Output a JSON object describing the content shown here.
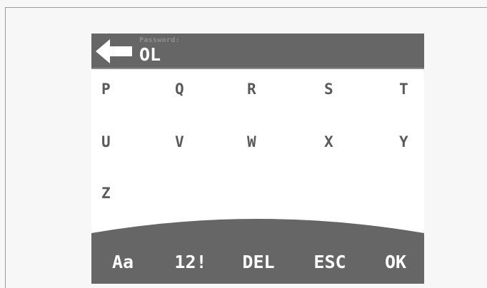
{
  "password": {
    "label": "Password:",
    "value": "OL"
  },
  "header": {
    "back_icon": "back-arrow-icon"
  },
  "keyboard": {
    "rows": [
      [
        "P",
        "Q",
        "R",
        "S",
        "T"
      ],
      [
        "U",
        "V",
        "W",
        "X",
        "Y"
      ],
      [
        "Z"
      ]
    ]
  },
  "actions": {
    "case": "Aa",
    "symbols": "12!",
    "delete": "DEL",
    "escape": "ESC",
    "ok": "OK"
  },
  "colors": {
    "header_bg": "#666666",
    "bar_bg": "#666666",
    "key_text": "#5a5a5a",
    "label_text": "#8e8e8e",
    "value_text": "#ffffff"
  }
}
